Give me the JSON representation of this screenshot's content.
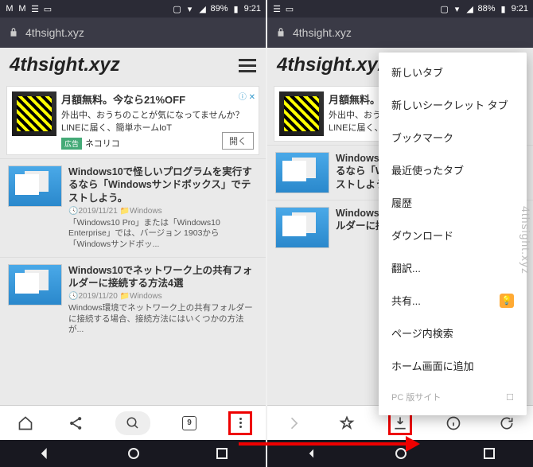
{
  "statusbar": {
    "battery_left": "89%",
    "battery_right": "88%",
    "time": "9:21"
  },
  "url": "4thsight.xyz",
  "site_title": "4thsight.xyz",
  "ad": {
    "title": "月額無料。今なら21%OFF",
    "line1": "外出中、おうちのことが気になってませんか？",
    "line2": "LINEに届く、簡単ホームIoT",
    "badge": "広告",
    "brand": "ネコリコ",
    "open": "開く",
    "x": "ⓘ ✕"
  },
  "articles": [
    {
      "title": "Windows10で怪しいプログラムを実行するなら「Windowsサンドボックス」でテストしよう。",
      "date": "2019/11/21",
      "cat": "Windows",
      "desc": "「Windows10 Pro」または「Windows10 Enterprise」では、バージョン 1903から「Windowsサンドボッ..."
    },
    {
      "title": "Windows10でネットワーク上の共有フォルダーに接続する方法4選",
      "date": "2019/11/20",
      "cat": "Windows",
      "desc": "Windows環境でネットワーク上の共有フォルダーに接続する場合、接続方法にはいくつかの方法が..."
    }
  ],
  "tab_count": "9",
  "menu_items": [
    "新しいタブ",
    "新しいシークレット タブ",
    "ブックマーク",
    "最近使ったタブ",
    "履歴",
    "ダウンロード",
    "翻訳...",
    "共有...",
    "ページ内検索",
    "ホーム画面に追加"
  ],
  "menu_last": "PC 版サイト",
  "watermark": "4thsight.xyz"
}
